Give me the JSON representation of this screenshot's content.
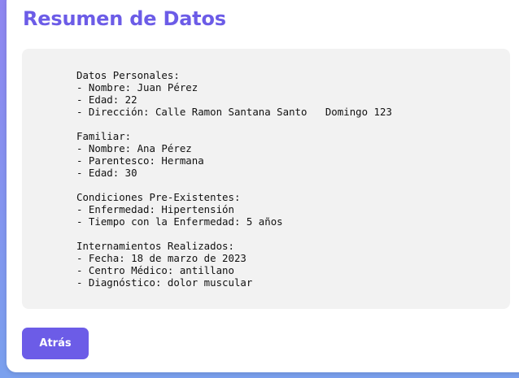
{
  "page": {
    "title": "Resumen de Datos"
  },
  "summary": {
    "text": "Datos Personales:\n- Nombre: Juan Pérez\n- Edad: 22\n- Dirección: Calle Ramon Santana Santo   Domingo 123\n\nFamiliar:\n- Nombre: Ana Pérez\n- Parentesco: Hermana\n- Edad: 30\n\nCondiciones Pre-Existentes:\n- Enfermedad: Hipertensión\n- Tiempo con la Enfermedad: 5 años\n\nInternamientos Realizados:\n- Fecha: 18 de marzo de 2023\n- Centro Médico: antillano\n- Diagnóstico: dolor muscular"
  },
  "actions": {
    "back_label": "Atrás"
  },
  "colors": {
    "accent": "#6c5ce7",
    "box_background": "#f2f2f2"
  }
}
